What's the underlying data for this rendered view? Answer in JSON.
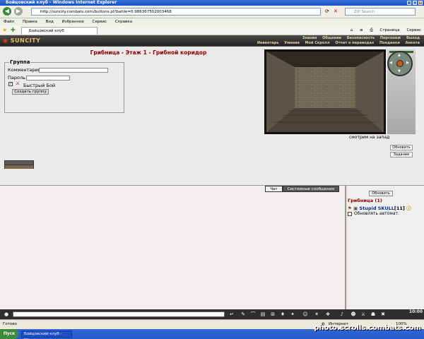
{
  "window": {
    "title": "Бойцовский клуб - Windows Internet Explorer"
  },
  "address": {
    "url": "http://suncity.combats.com/buttons.pl?battle=0.986367502003468",
    "search_placeholder": "ZIP Search"
  },
  "menu": [
    "Файл",
    "Правка",
    "Вид",
    "Избранное",
    "Сервис",
    "Справка"
  ],
  "tab": {
    "label": "Бойцовский клуб"
  },
  "commands": {
    "page": "Страница",
    "tools": "Сервис"
  },
  "game": {
    "logo": "SUNCITY",
    "nav_top": [
      "Знания",
      "Общение",
      "Безопасность",
      "Персонаж",
      "Выход"
    ],
    "nav_bottom": [
      "Инвентарь",
      "Умения",
      "Мой Скролл",
      "Отчет о переводах",
      "Поединки",
      "Анкета"
    ]
  },
  "room": {
    "title": "Грибница - Этаж 1 - Грибной коридор"
  },
  "group": {
    "legend": "Группа",
    "comment_label": "Комментарий",
    "password_label": "Пароль",
    "quick_fight": "Быстрый Бой",
    "create_button": "Создать группу",
    "quick_fight_checked": true
  },
  "scene": {
    "view_direction": "смотрим на запад",
    "refresh_button": "Обновить",
    "tasks_button": "Задание"
  },
  "chat": {
    "tab_chat": "Чат",
    "tab_system": "Системные сообщения"
  },
  "who": {
    "refresh": "Обновить",
    "location": "Грибница (1)",
    "player_name": "Stupid SKULL",
    "player_level": "[11]",
    "auto_refresh": "Обновлять автомат."
  },
  "clock": "10:00",
  "status": {
    "ready": "Готово",
    "zone": "Интернет",
    "zoom": "100%"
  },
  "taskbar": {
    "start": "Пуск",
    "item": "Бойцовский клуб - Wi..."
  },
  "watermark": "photo.scrolls.combats.com"
}
